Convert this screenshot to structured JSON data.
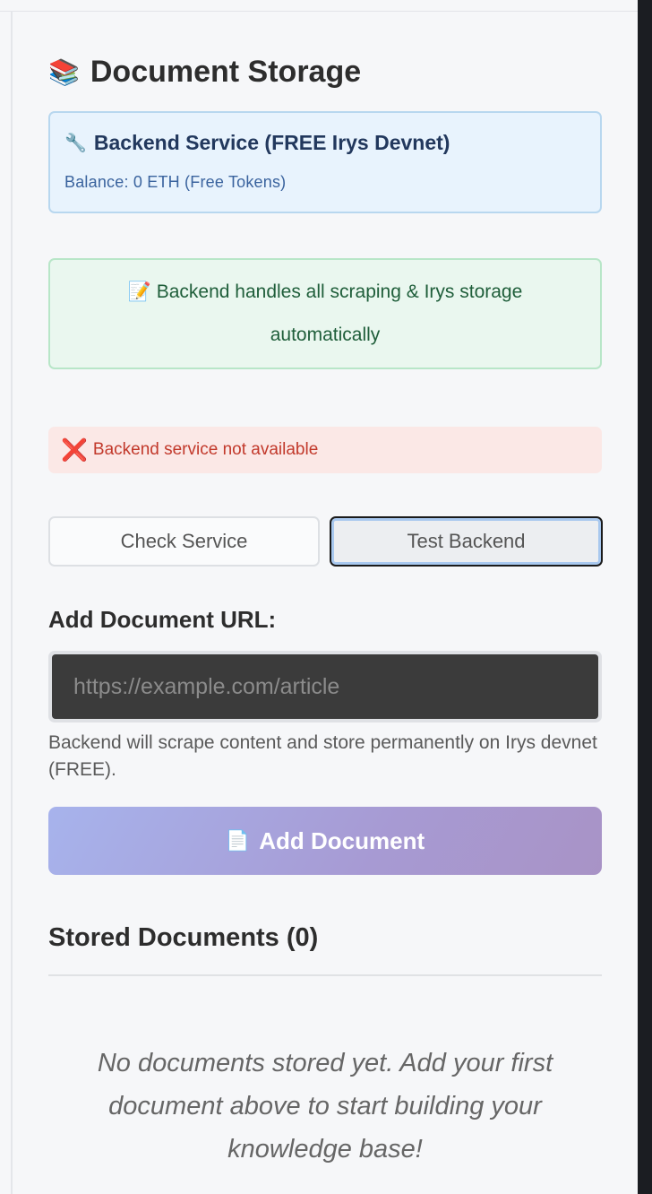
{
  "header": {
    "emoji": "📚",
    "title": "Document Storage"
  },
  "service": {
    "icon": "wrench-icon",
    "emoji": "🔧",
    "title": "Backend Service (FREE Irys Devnet)",
    "balance": "Balance: 0 ETH (Free Tokens)"
  },
  "info": {
    "emoji": "📝",
    "text": "Backend handles all scraping & Irys storage automatically"
  },
  "error": {
    "icon": "error-x-icon",
    "symbol": "❌",
    "text": "Backend service not available"
  },
  "buttons": {
    "check": "Check Service",
    "test": "Test Backend"
  },
  "form": {
    "label": "Add Document URL:",
    "placeholder": "https://example.com/article",
    "value": "",
    "helper": "Backend will scrape content and store permanently on Irys devnet (FREE).",
    "submit_emoji": "📄",
    "submit_label": "Add Document"
  },
  "stored": {
    "title": "Stored Documents (0)",
    "empty_message": "No documents stored yet. Add your first document above to start building your knowledge base!"
  },
  "colors": {
    "service_bg": "#e8f3fd",
    "info_bg": "#eaf7ef",
    "error_bg": "#fbe8e6",
    "error_text": "#c2392b",
    "gradient_start": "#a7b3ec",
    "gradient_end": "#a893c6"
  }
}
